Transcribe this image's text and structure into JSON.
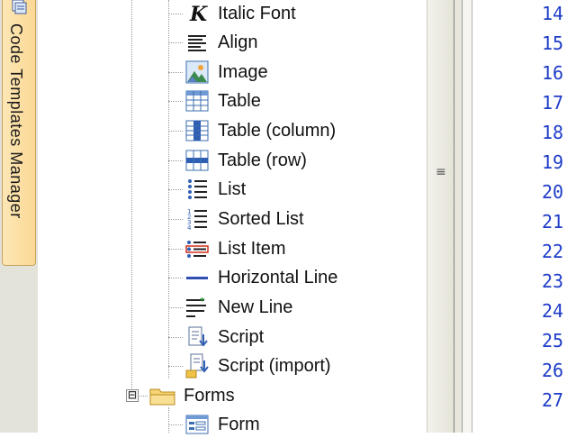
{
  "side_tab": {
    "label": "Code Templates Manager",
    "icon": "templates-manager-icon"
  },
  "tree": {
    "items": [
      {
        "label": "Italic Font",
        "icon": "italic-font-icon"
      },
      {
        "label": "Align",
        "icon": "align-icon"
      },
      {
        "label": "Image",
        "icon": "image-icon"
      },
      {
        "label": "Table",
        "icon": "table-icon"
      },
      {
        "label": "Table (column)",
        "icon": "table-column-icon"
      },
      {
        "label": "Table (row)",
        "icon": "table-row-icon"
      },
      {
        "label": "List",
        "icon": "list-icon"
      },
      {
        "label": "Sorted List",
        "icon": "sorted-list-icon"
      },
      {
        "label": "List Item",
        "icon": "list-item-icon"
      },
      {
        "label": "Horizontal Line",
        "icon": "horizontal-line-icon"
      },
      {
        "label": "New Line",
        "icon": "new-line-icon"
      },
      {
        "label": "Script",
        "icon": "script-icon"
      },
      {
        "label": "Script (import)",
        "icon": "script-import-icon"
      }
    ],
    "folder": {
      "label": "Forms",
      "icon": "folder-icon",
      "expander": "⊟"
    },
    "child": {
      "label": "Form",
      "icon": "form-icon"
    }
  },
  "splitter": {
    "grip": "≡"
  },
  "line_numbers": [
    "14",
    "15",
    "16",
    "17",
    "18",
    "19",
    "20",
    "21",
    "22",
    "23",
    "24",
    "25",
    "26",
    "27"
  ],
  "colors": {
    "line_number": "#1e3cc8",
    "side_tab": "#fbd894"
  }
}
